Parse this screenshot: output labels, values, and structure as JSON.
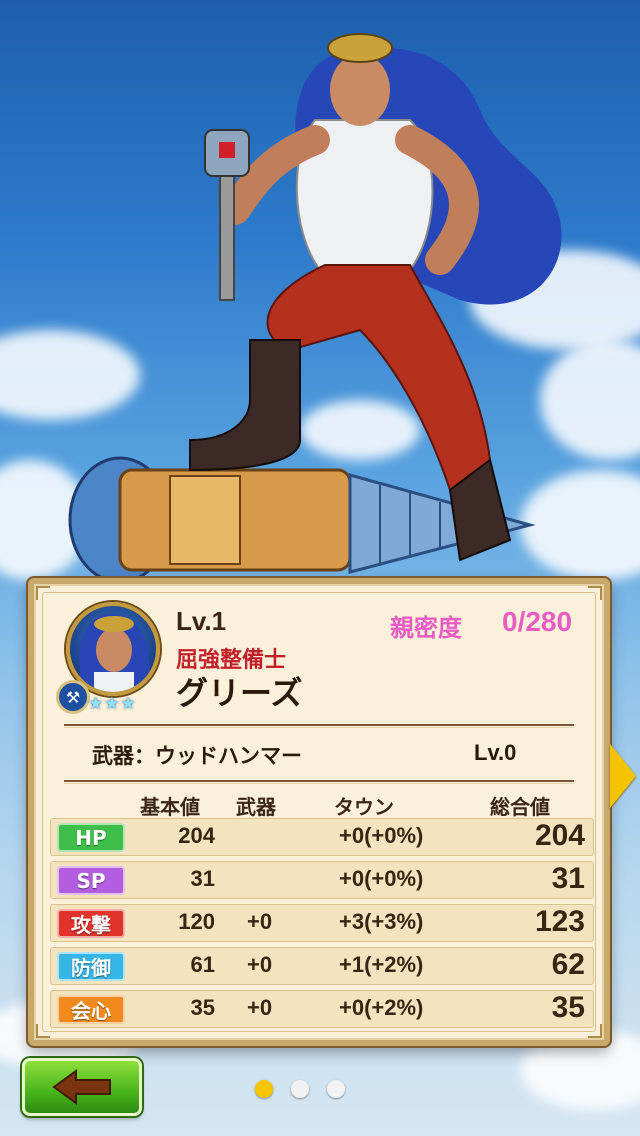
{
  "character": {
    "level_label": "Lv.1",
    "title": "屈強整備士",
    "name": "グリーズ",
    "affinity_label": "親密度",
    "affinity_value": "0/280",
    "rarity_stars": 3,
    "weapon_type_icon": "hammer-icon"
  },
  "weapon": {
    "label": "武器：ウッドハンマー",
    "level": "Lv.0"
  },
  "stats": {
    "headers": {
      "base": "基本値",
      "weapon": "武器",
      "town": "タウン",
      "total": "総合値"
    },
    "rows": [
      {
        "label": "HP",
        "color": "#3fbf4a",
        "base": "204",
        "weapon": "",
        "town": "+0(+0%)",
        "total": "204"
      },
      {
        "label": "SP",
        "color": "#b35ee0",
        "base": "31",
        "weapon": "",
        "town": "+0(+0%)",
        "total": "31"
      },
      {
        "label": "攻撃",
        "color": "#e0332c",
        "base": "120",
        "weapon": "+0",
        "town": "+3(+3%)",
        "total": "123"
      },
      {
        "label": "防御",
        "color": "#35b6e6",
        "base": "61",
        "weapon": "+0",
        "town": "+1(+2%)",
        "total": "62"
      },
      {
        "label": "会心",
        "color": "#f08a1d",
        "base": "35",
        "weapon": "+0",
        "town": "+0(+2%)",
        "total": "35"
      }
    ]
  },
  "navigation": {
    "back_icon": "arrow-left-icon",
    "next_icon": "chevron-right-icon",
    "pages": 3,
    "active_page": 1
  },
  "colors": {
    "affinity": "#e85cc4",
    "title_red": "#c0212b",
    "panel_bg": "#fbf1da",
    "back_button": "#47b41c",
    "page_dot_active": "#f7c400"
  }
}
